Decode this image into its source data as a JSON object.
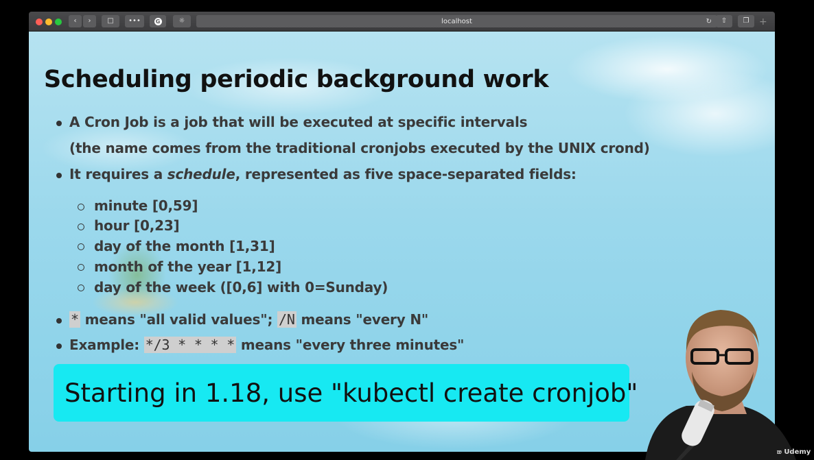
{
  "browser": {
    "address": "localhost",
    "toolbar_icons": [
      "back-icon",
      "forward-icon",
      "sidebar-icon",
      "more-icon",
      "grammarly-icon",
      "sun-icon",
      "reload-icon",
      "share-icon",
      "tabs-icon",
      "new-tab-icon"
    ]
  },
  "slide": {
    "title": "Scheduling periodic background work",
    "bullet1_line1": "A Cron Job is a job that will be executed at specific intervals",
    "bullet1_line2": "(the name comes from the traditional cronjobs executed by the UNIX crond)",
    "bullet2_pre": "It requires a ",
    "bullet2_em": "schedule",
    "bullet2_post": ", represented as five space-separated fields:",
    "fields": [
      "minute [0,59]",
      "hour [0,23]",
      "day of the month [1,31]",
      "month of the year [1,12]",
      "day of the week ([0,6] with 0=Sunday)"
    ],
    "bullet3": {
      "code1": "*",
      "text1": " means \"all valid values\"; ",
      "code2": "/N",
      "text2": " means \"every N\""
    },
    "bullet4": {
      "pre": "Example: ",
      "code": "*/3 * * * *",
      "post": " means \"every three minutes\""
    },
    "banner": "Starting in 1.18, use \"kubectl create cronjob\""
  },
  "watermark": "Udemy",
  "colors": {
    "banner": "#17e9f2",
    "sky": "#9bd8ec"
  }
}
